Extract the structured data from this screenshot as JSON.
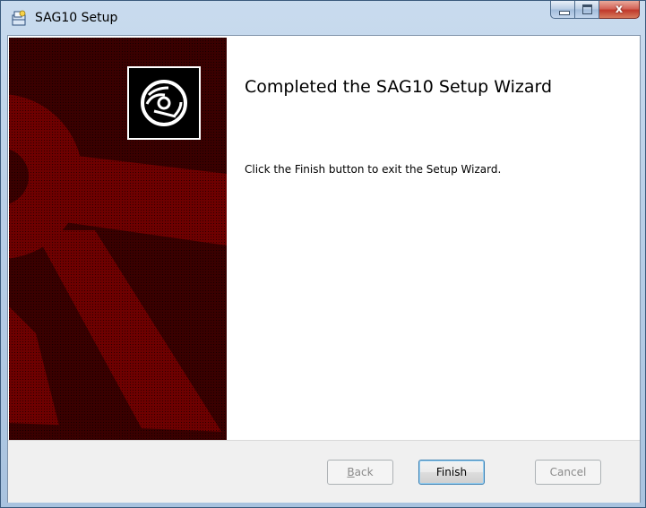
{
  "window": {
    "title": "SAG10 Setup",
    "app_icon": "installer-icon",
    "caption_buttons": {
      "minimize_icon": "minimize-icon",
      "maximize_icon": "maximize-icon",
      "close_icon": "close-icon",
      "close_glyph": "x"
    }
  },
  "banner": {
    "logo_icon": "disc-icon",
    "background_color": "#7a0000"
  },
  "content": {
    "heading": "Completed the SAG10 Setup Wizard",
    "message": "Click the Finish button to exit the Setup Wizard."
  },
  "footer": {
    "back_access": "B",
    "back_rest": "ack",
    "finish_label": "Finish",
    "cancel_label": "Cancel"
  },
  "state": {
    "back_enabled": false,
    "cancel_enabled": false,
    "default_button": "finish"
  }
}
